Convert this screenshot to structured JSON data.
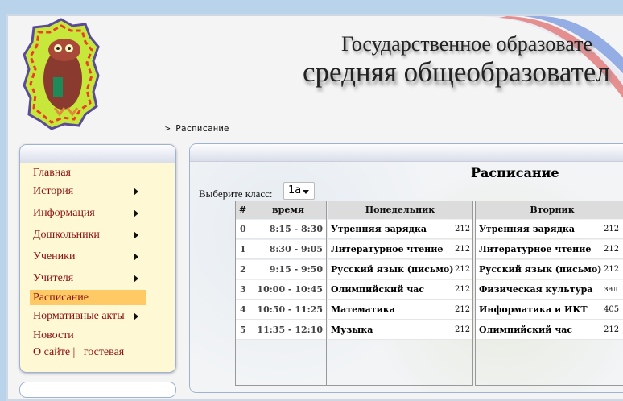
{
  "header": {
    "line1": "Государственное образовате",
    "line2": "средняя общеобразовател"
  },
  "breadcrumb": {
    "separator": ">",
    "current": "Расписание"
  },
  "sidebar": {
    "items": [
      {
        "label": "Главная",
        "submenu": false
      },
      {
        "label": "История",
        "submenu": true
      },
      {
        "label": "Информация",
        "submenu": true
      },
      {
        "label": "Дошкольники",
        "submenu": true
      },
      {
        "label": "Ученики",
        "submenu": true
      },
      {
        "label": "Учителя",
        "submenu": true
      },
      {
        "label": "Расписание",
        "submenu": false,
        "active": true
      },
      {
        "label": "Нормативные акты",
        "submenu": true
      },
      {
        "label": "Новости",
        "submenu": false
      }
    ],
    "footer_links": [
      "О сайте",
      "гостевая"
    ],
    "footer_separator": "|"
  },
  "main": {
    "title": "Расписание",
    "class_label": "Выберите класс:",
    "class_value": "1а",
    "table": {
      "headers": [
        "#",
        "время",
        "Понедельник",
        "Вторник"
      ],
      "rows": [
        {
          "n": "0",
          "time": "8:15 - 8:30",
          "mon": "Утренняя зарядка",
          "mon_room": "212",
          "tue": "Утренняя зарядка",
          "tue_room": "212"
        },
        {
          "n": "1",
          "time": "8:30 - 9:05",
          "mon": "Литературное чтение",
          "mon_room": "212",
          "tue": "Литературное чтение",
          "tue_room": "212"
        },
        {
          "n": "2",
          "time": "9:15 - 9:50",
          "mon": "Русский язык (письмо)",
          "mon_room": "212",
          "tue": "Русский язык (письмо)",
          "tue_room": "212"
        },
        {
          "n": "3",
          "time": "10:00 - 10:45",
          "mon": "Олимпийский час",
          "mon_room": "212",
          "tue": "Физическая культура",
          "tue_room": "зал"
        },
        {
          "n": "4",
          "time": "10:50 - 11:25",
          "mon": "Математика",
          "mon_room": "212",
          "tue": "Информатика и ИКТ",
          "tue_room": "405"
        },
        {
          "n": "5",
          "time": "11:35 - 12:10",
          "mon": "Музыка",
          "mon_room": "212",
          "tue": "Олимпийский час",
          "tue_room": "212"
        }
      ]
    }
  },
  "colors": {
    "menu_text": "#8b1010",
    "menu_active_bg": "#ffca66",
    "sidebar_bg": "#fff8d4",
    "page_bg": "#b9d3ea"
  }
}
